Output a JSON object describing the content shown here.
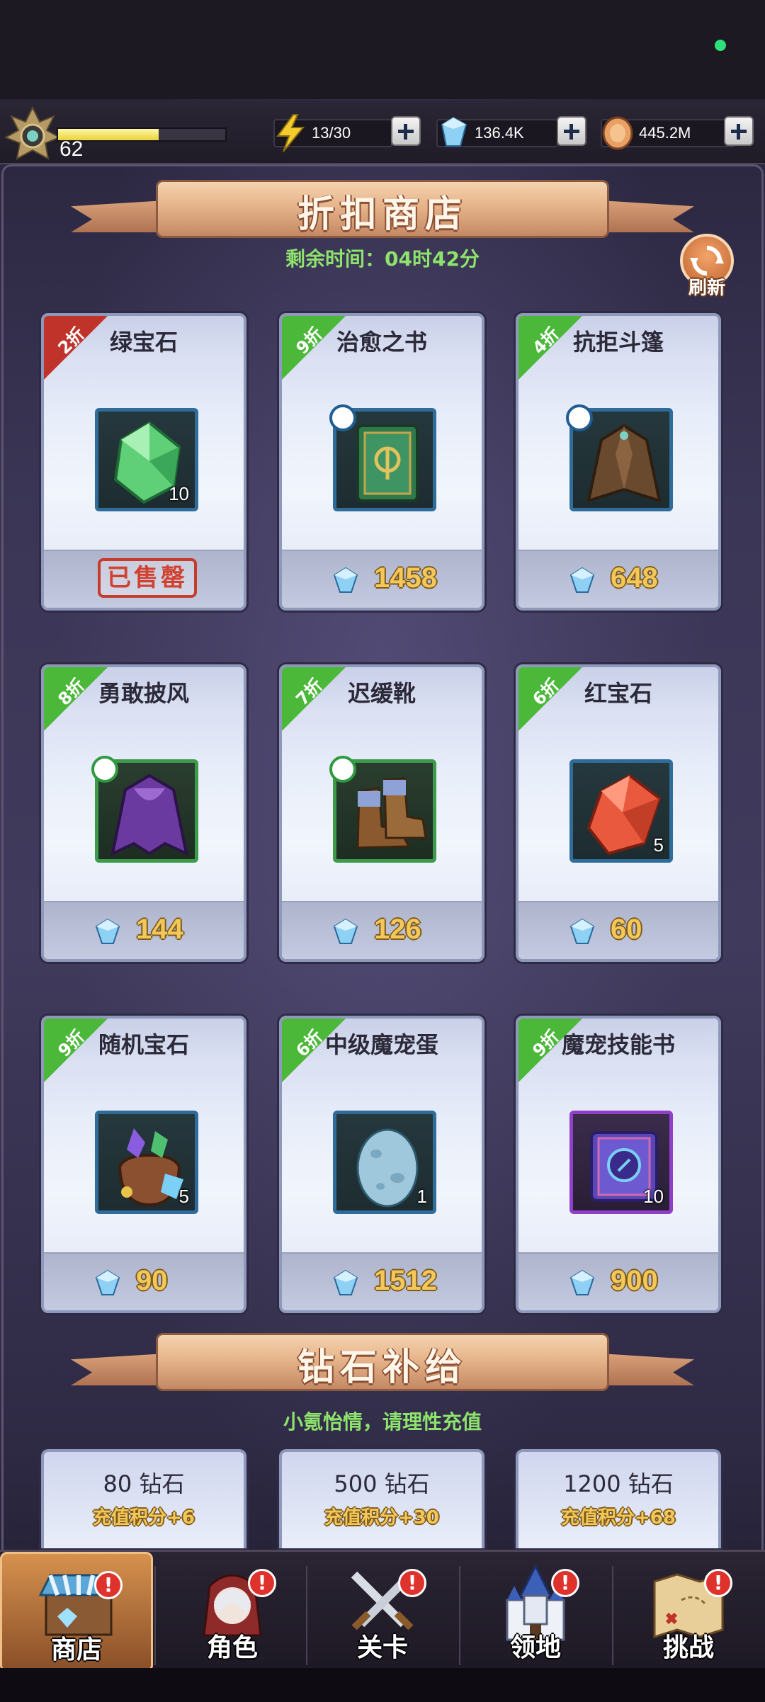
{
  "player": {
    "level": "62",
    "xp_fraction": 0.6
  },
  "resources": {
    "energy": {
      "value": "13/30",
      "icon": "lightning-icon"
    },
    "diamonds": {
      "value": "136.4K",
      "icon": "diamond-icon"
    },
    "gold": {
      "value": "445.2M",
      "icon": "coin-icon"
    }
  },
  "shop": {
    "title": "折扣商店",
    "timer": "剩余时间：04时42分",
    "refresh_label": "刷新",
    "items": [
      {
        "name": "绿宝石",
        "discount": "2折",
        "tag_color": "#c0332a",
        "qty": "10",
        "sold_out": true,
        "sold_label": "已售罄",
        "icon": "green-gem-icon",
        "price": ""
      },
      {
        "name": "治愈之书",
        "discount": "9折",
        "tag_color": "#4cb83a",
        "qty": "",
        "sold_out": false,
        "price": "1458",
        "icon": "healing-book-icon"
      },
      {
        "name": "抗拒斗篷",
        "discount": "4折",
        "tag_color": "#4cb83a",
        "qty": "",
        "sold_out": false,
        "price": "648",
        "icon": "brown-cloak-icon"
      },
      {
        "name": "勇敢披风",
        "discount": "8折",
        "tag_color": "#4cb83a",
        "qty": "",
        "sold_out": false,
        "price": "144",
        "icon": "purple-cloak-icon"
      },
      {
        "name": "迟缓靴",
        "discount": "7折",
        "tag_color": "#4cb83a",
        "qty": "",
        "sold_out": false,
        "price": "126",
        "icon": "boots-icon"
      },
      {
        "name": "红宝石",
        "discount": "6折",
        "tag_color": "#4cb83a",
        "qty": "5",
        "sold_out": false,
        "price": "60",
        "icon": "red-gem-icon"
      },
      {
        "name": "随机宝石",
        "discount": "9折",
        "tag_color": "#4cb83a",
        "qty": "5",
        "sold_out": false,
        "price": "90",
        "icon": "gem-bag-icon"
      },
      {
        "name": "中级魔宠蛋",
        "discount": "6折",
        "tag_color": "#4cb83a",
        "qty": "1",
        "sold_out": false,
        "price": "1512",
        "icon": "egg-icon"
      },
      {
        "name": "魔宠技能书",
        "discount": "9折",
        "tag_color": "#4cb83a",
        "qty": "10",
        "sold_out": false,
        "price": "900",
        "icon": "skill-book-icon"
      }
    ]
  },
  "recharge": {
    "title": "钻石补给",
    "note": "小氪怡情，请理性充值",
    "packs": [
      {
        "amount": "80 钻石",
        "points": "充值积分+6"
      },
      {
        "amount": "500 钻石",
        "points": "充值积分+30"
      },
      {
        "amount": "1200 钻石",
        "points": "充值积分+68"
      }
    ]
  },
  "nav": [
    {
      "label": "商店",
      "icon": "shop-stall-icon",
      "active": true
    },
    {
      "label": "角色",
      "icon": "character-icon",
      "active": false
    },
    {
      "label": "关卡",
      "icon": "crossed-swords-icon",
      "active": false
    },
    {
      "label": "领地",
      "icon": "castle-icon",
      "active": false
    },
    {
      "label": "挑战",
      "icon": "map-scroll-icon",
      "active": false
    }
  ],
  "alert_symbol": "!"
}
